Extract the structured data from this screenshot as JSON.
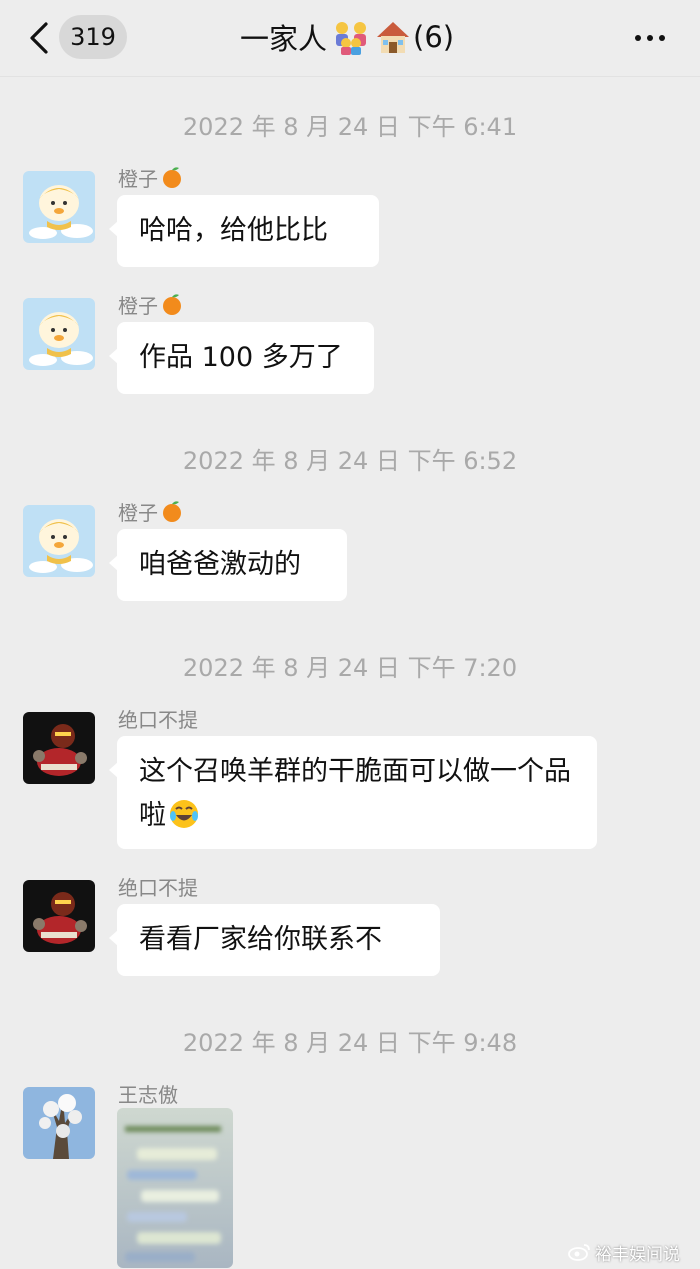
{
  "header": {
    "unread_count": "319",
    "title": "一家人",
    "member_count": "(6)"
  },
  "messages": [
    {
      "timestamp": "2022 年 8 月 24 日  下午 6:41"
    },
    {
      "sender": "橙子",
      "text": "哈哈，给他比比"
    },
    {
      "sender": "橙子",
      "text": "作品 100 多万了"
    },
    {
      "timestamp": "2022 年 8 月 24 日  下午 6:52"
    },
    {
      "sender": "橙子",
      "text": "咱爸爸激动的"
    },
    {
      "timestamp": "2022 年 8 月 24 日  下午 7:20"
    },
    {
      "sender": "绝口不提",
      "text": "这个召唤羊群的干脆面可以做一个品啦"
    },
    {
      "sender": "绝口不提",
      "text": "看看厂家给你联系不"
    },
    {
      "timestamp": "2022 年 8 月 24 日  下午 9:48"
    },
    {
      "sender": "王志傲",
      "type": "image"
    }
  ],
  "watermark": "裕丰娱间说"
}
